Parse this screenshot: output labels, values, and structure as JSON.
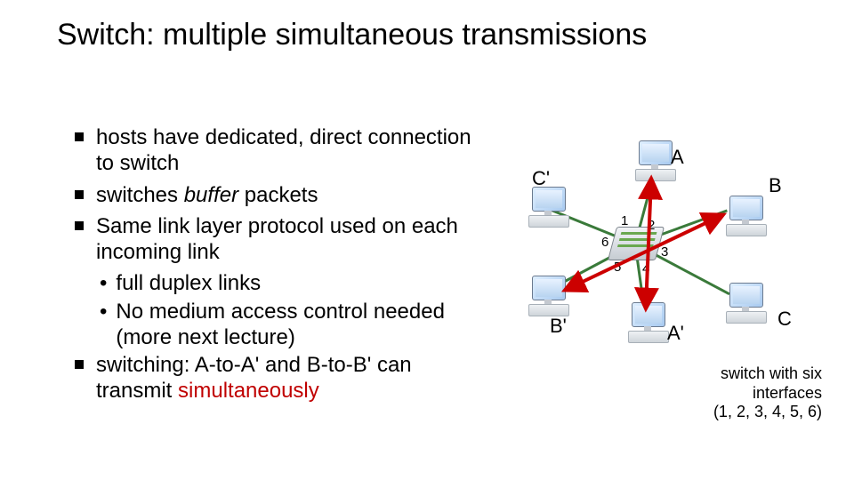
{
  "title": "Switch: multiple simultaneous transmissions",
  "bullets": {
    "b0": "hosts have dedicated, direct connection to switch",
    "b1_a": "switches ",
    "b1_b": "buffer",
    "b1_c": " packets",
    "b2": "Same link layer protocol used on each incoming link",
    "s0": "full duplex links",
    "s1": "No medium access control needed (more next lecture)",
    "b3_a": "switching: A-to-A' and B-to-B' can transmit ",
    "b3_b": "simultaneously"
  },
  "hosts": {
    "A": "A",
    "B": "B",
    "C": "C",
    "Ap": "A'",
    "Bp": "B'",
    "Cp": "C'"
  },
  "ports": {
    "p1": "1",
    "p2": "2",
    "p3": "3",
    "p4": "4",
    "p5": "5",
    "p6": "6"
  },
  "caption": {
    "l1": "switch with six",
    "l2": "interfaces",
    "l3": "(1, 2, 3, 4, 5, 6)"
  }
}
